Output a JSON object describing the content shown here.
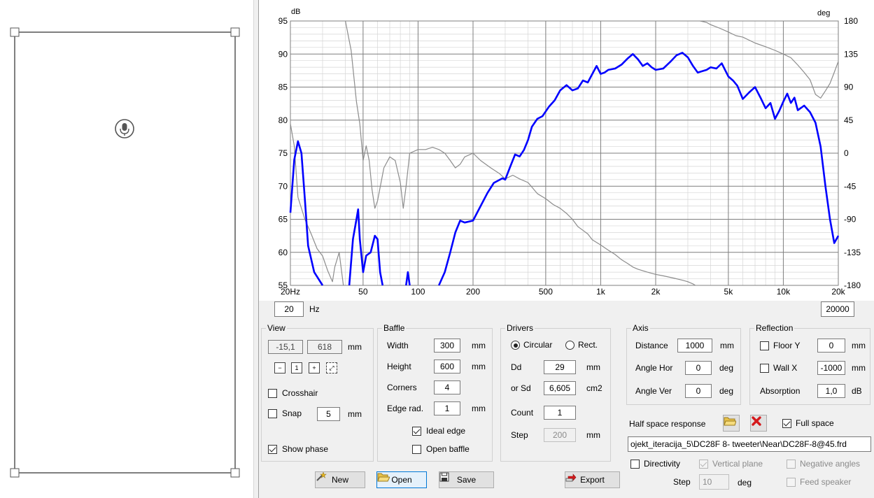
{
  "colors": {
    "magnitude": "#0000ff",
    "phase": "#8c8c8c",
    "grid_major": "#7f7f7f",
    "grid_minor": "#d6d6d6",
    "delete_red": "#d4191c",
    "folder_yellow": "#e8c24a"
  },
  "baffle_view": {
    "microphone_icon": "microphone-icon"
  },
  "chart": {
    "left_unit": "dB",
    "right_unit": "deg",
    "freq_min_value": "20",
    "freq_min_unit": "Hz",
    "freq_max_value": "20000"
  },
  "chart_data": {
    "type": "line",
    "x_scale": "log",
    "xlim": [
      20,
      20000
    ],
    "ylim_left": [
      55,
      95
    ],
    "ylim_right": [
      -180,
      180
    ],
    "x_ticks": [
      {
        "value": 20,
        "label": "20Hz"
      },
      {
        "value": 50,
        "label": "50"
      },
      {
        "value": 100,
        "label": "100"
      },
      {
        "value": 200,
        "label": "200"
      },
      {
        "value": 500,
        "label": "500"
      },
      {
        "value": 1000,
        "label": "1k"
      },
      {
        "value": 2000,
        "label": "2k"
      },
      {
        "value": 5000,
        "label": "5k"
      },
      {
        "value": 10000,
        "label": "10k"
      },
      {
        "value": 20000,
        "label": "20k"
      }
    ],
    "y_left_ticks": [
      95,
      90,
      85,
      80,
      75,
      70,
      65,
      60,
      55
    ],
    "y_right_ticks": [
      180,
      135,
      90,
      45,
      0,
      -45,
      -90,
      -135,
      -180
    ],
    "grid": true,
    "series": [
      {
        "axis": "left",
        "color": "#0000ff",
        "segments": [
          [
            [
              20,
              66
            ],
            [
              21,
              74
            ],
            [
              22,
              76.8
            ],
            [
              23,
              75
            ],
            [
              24,
              68
            ],
            [
              25,
              61
            ],
            [
              27,
              57
            ],
            [
              30,
              55
            ]
          ],
          [
            [
              42,
              55
            ],
            [
              44,
              62
            ],
            [
              46,
              65
            ],
            [
              47,
              66.5
            ],
            [
              48,
              62
            ],
            [
              50,
              57
            ],
            [
              52,
              59.5
            ],
            [
              55,
              60
            ],
            [
              58,
              62.5
            ],
            [
              60,
              62
            ],
            [
              62,
              57
            ],
            [
              64,
              55
            ]
          ],
          [
            [
              86,
              55
            ],
            [
              88,
              57
            ],
            [
              90,
              55
            ]
          ],
          [
            [
              130,
              55
            ],
            [
              140,
              57
            ],
            [
              150,
              60
            ],
            [
              160,
              63
            ],
            [
              170,
              64.8
            ],
            [
              180,
              64.5
            ],
            [
              200,
              64.8
            ],
            [
              220,
              67
            ],
            [
              240,
              69
            ],
            [
              260,
              70.5
            ],
            [
              290,
              71.2
            ],
            [
              300,
              71
            ],
            [
              320,
              73
            ],
            [
              340,
              74.8
            ],
            [
              360,
              74.5
            ],
            [
              380,
              75.5
            ],
            [
              400,
              77
            ],
            [
              420,
              79
            ],
            [
              450,
              80.2
            ],
            [
              480,
              80.6
            ],
            [
              520,
              82
            ],
            [
              560,
              83
            ],
            [
              600,
              84.5
            ],
            [
              650,
              85.3
            ],
            [
              700,
              84.5
            ],
            [
              750,
              84.8
            ],
            [
              800,
              86
            ],
            [
              850,
              85.7
            ],
            [
              900,
              87
            ],
            [
              950,
              88.2
            ],
            [
              1000,
              87
            ],
            [
              1050,
              87.2
            ],
            [
              1100,
              87.6
            ],
            [
              1200,
              87.8
            ],
            [
              1300,
              88.4
            ],
            [
              1400,
              89.3
            ],
            [
              1500,
              90
            ],
            [
              1600,
              89.2
            ],
            [
              1700,
              88.2
            ],
            [
              1800,
              88.6
            ],
            [
              1900,
              88
            ],
            [
              2000,
              87.6
            ],
            [
              2200,
              87.8
            ],
            [
              2400,
              88.8
            ],
            [
              2600,
              89.8
            ],
            [
              2800,
              90.2
            ],
            [
              3000,
              89.5
            ],
            [
              3200,
              88.2
            ],
            [
              3400,
              87.2
            ],
            [
              3600,
              87.4
            ],
            [
              3800,
              87.6
            ],
            [
              4000,
              88
            ],
            [
              4300,
              87.8
            ],
            [
              4600,
              88.6
            ],
            [
              5000,
              86.6
            ],
            [
              5300,
              86
            ],
            [
              5600,
              85.2
            ],
            [
              6000,
              83.2
            ],
            [
              6500,
              84.2
            ],
            [
              7000,
              85
            ],
            [
              7500,
              83.4
            ],
            [
              8000,
              81.8
            ],
            [
              8500,
              82.6
            ],
            [
              9000,
              80.2
            ],
            [
              9500,
              81.4
            ],
            [
              10000,
              82.8
            ],
            [
              10500,
              84
            ],
            [
              11000,
              82.6
            ],
            [
              11500,
              83.4
            ],
            [
              12000,
              81.5
            ],
            [
              13000,
              82.2
            ],
            [
              14000,
              81.2
            ],
            [
              15000,
              79.6
            ],
            [
              16000,
              76
            ],
            [
              17000,
              70
            ],
            [
              18000,
              65
            ],
            [
              19000,
              61.4
            ],
            [
              20000,
              62.5
            ]
          ]
        ]
      },
      {
        "axis": "right",
        "color": "#8c8c8c",
        "segments": [
          [
            [
              20,
              40
            ],
            [
              21,
              10
            ],
            [
              22,
              -60
            ],
            [
              24,
              -90
            ],
            [
              26,
              -110
            ],
            [
              28,
              -130
            ],
            [
              30,
              -140
            ],
            [
              32,
              -160
            ],
            [
              34,
              -175
            ],
            [
              35,
              -155
            ],
            [
              37,
              -135
            ],
            [
              39,
              -180
            ]
          ],
          [
            [
              40,
              180
            ],
            [
              43,
              140
            ],
            [
              46,
              70
            ],
            [
              48,
              40
            ],
            [
              50,
              -10
            ],
            [
              52,
              10
            ],
            [
              54,
              -10
            ],
            [
              56,
              -50
            ],
            [
              58,
              -75
            ],
            [
              60,
              -65
            ],
            [
              65,
              -20
            ],
            [
              70,
              -5
            ],
            [
              75,
              -10
            ],
            [
              80,
              -40
            ],
            [
              83,
              -75
            ],
            [
              86,
              -45
            ],
            [
              90,
              0
            ],
            [
              100,
              5
            ],
            [
              110,
              5
            ],
            [
              120,
              8
            ],
            [
              130,
              5
            ],
            [
              140,
              0
            ],
            [
              150,
              -10
            ],
            [
              160,
              -20
            ],
            [
              170,
              -15
            ],
            [
              180,
              -5
            ],
            [
              200,
              0
            ],
            [
              220,
              -10
            ],
            [
              250,
              -20
            ],
            [
              280,
              -28
            ],
            [
              300,
              -35
            ],
            [
              330,
              -30
            ],
            [
              360,
              -35
            ],
            [
              400,
              -40
            ],
            [
              450,
              -55
            ],
            [
              500,
              -62
            ],
            [
              550,
              -70
            ],
            [
              600,
              -75
            ],
            [
              650,
              -82
            ],
            [
              700,
              -90
            ],
            [
              750,
              -100
            ],
            [
              800,
              -105
            ],
            [
              850,
              -110
            ],
            [
              900,
              -118
            ],
            [
              1000,
              -125
            ],
            [
              1100,
              -132
            ],
            [
              1200,
              -138
            ],
            [
              1300,
              -145
            ],
            [
              1400,
              -150
            ],
            [
              1500,
              -155
            ],
            [
              1600,
              -158
            ],
            [
              1800,
              -162
            ],
            [
              2000,
              -165
            ],
            [
              2200,
              -167
            ],
            [
              2500,
              -170
            ],
            [
              2800,
              -173
            ],
            [
              3000,
              -175
            ],
            [
              3200,
              -178
            ],
            [
              3300,
              -180
            ]
          ],
          [
            [
              3500,
              180
            ],
            [
              3800,
              178
            ],
            [
              4000,
              175
            ],
            [
              4500,
              170
            ],
            [
              5000,
              165
            ],
            [
              5500,
              160
            ],
            [
              6000,
              158
            ],
            [
              7000,
              150
            ],
            [
              8000,
              145
            ],
            [
              9000,
              140
            ],
            [
              10000,
              135
            ],
            [
              11000,
              130
            ],
            [
              12000,
              120
            ],
            [
              13000,
              110
            ],
            [
              14000,
              100
            ],
            [
              15000,
              80
            ],
            [
              16000,
              75
            ],
            [
              17000,
              85
            ],
            [
              18000,
              95
            ],
            [
              19000,
              110
            ],
            [
              20000,
              125
            ]
          ]
        ]
      }
    ]
  },
  "view_group": {
    "title": "View",
    "x_value": "-15,1",
    "y_value": "618",
    "unit": "mm",
    "crosshair_label": "Crosshair",
    "snap_label": "Snap",
    "snap_value": "5",
    "snap_unit": "mm",
    "show_phase_label": "Show phase"
  },
  "baffle_group": {
    "title": "Baffle",
    "width_label": "Width",
    "width_value": "300",
    "width_unit": "mm",
    "height_label": "Height",
    "height_value": "600",
    "height_unit": "mm",
    "corners_label": "Corners",
    "corners_value": "4",
    "edge_rad_label": "Edge rad.",
    "edge_rad_value": "1",
    "edge_rad_unit": "mm",
    "ideal_edge_label": "Ideal edge",
    "open_baffle_label": "Open baffle"
  },
  "drivers_group": {
    "title": "Drivers",
    "circular_label": "Circular",
    "rect_label": "Rect.",
    "dd_label": "Dd",
    "dd_value": "29",
    "dd_unit": "mm",
    "sd_label": "or Sd",
    "sd_value": "6,605",
    "sd_unit": "cm2",
    "count_label": "Count",
    "count_value": "1",
    "step_label": "Step",
    "step_value": "200",
    "step_unit": "mm"
  },
  "axis_group": {
    "title": "Axis",
    "distance_label": "Distance",
    "distance_value": "1000",
    "distance_unit": "mm",
    "angle_hor_label": "Angle Hor",
    "angle_hor_value": "0",
    "angle_hor_unit": "deg",
    "angle_ver_label": "Angle Ver",
    "angle_ver_value": "0",
    "angle_ver_unit": "deg"
  },
  "reflection_group": {
    "title": "Reflection",
    "floor_label": "Floor Y",
    "floor_value": "0",
    "floor_unit": "mm",
    "wall_label": "Wall  X",
    "wall_value": "-1000",
    "wall_unit": "mm",
    "absorption_label": "Absorption",
    "absorption_value": "1,0",
    "absorption_unit": "dB"
  },
  "half_space": {
    "label": "Half space response",
    "full_space_label": "Full space",
    "file_path": "ojekt_iteracija_5\\DC28F 8- tweeter\\Near\\DC28F-8@45.frd"
  },
  "directivity": {
    "directivity_label": "Directivity",
    "vertical_plane_label": "Vertical plane",
    "negative_angles_label": "Negative angles",
    "step_label": "Step",
    "step_value": "10",
    "step_unit": "deg",
    "feed_speaker_label": "Feed speaker"
  },
  "buttons": {
    "new_label": "New",
    "open_label": "Open",
    "save_label": "Save",
    "export_label": "Export"
  }
}
